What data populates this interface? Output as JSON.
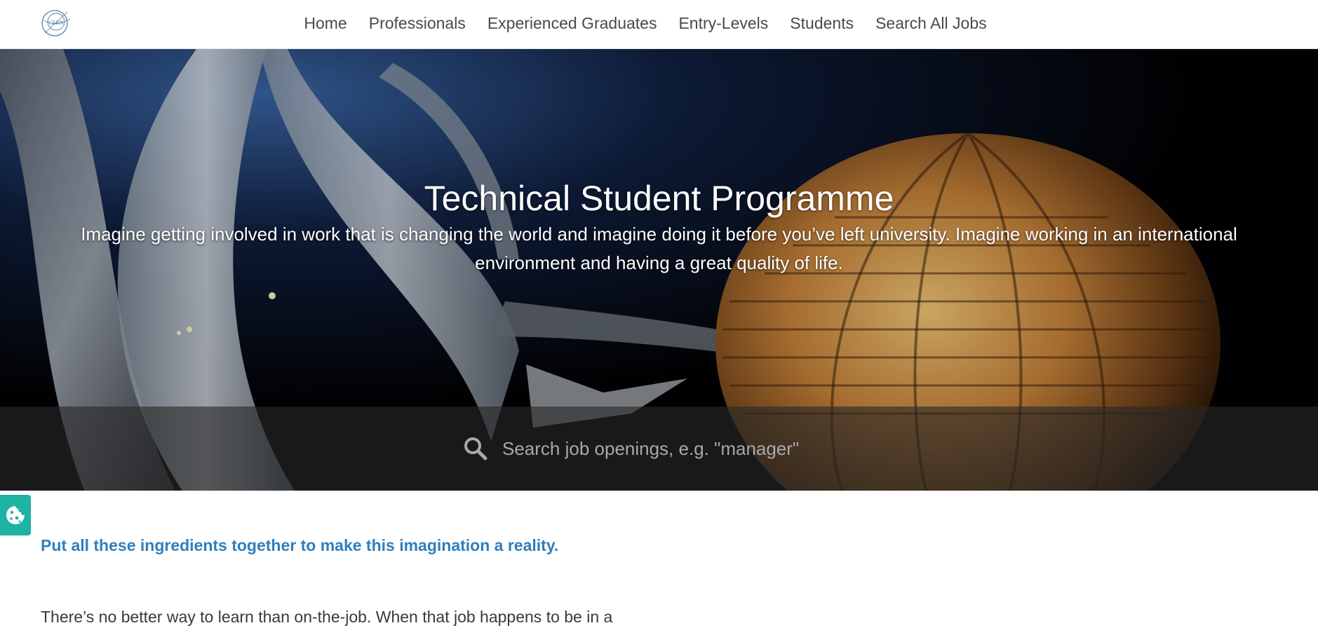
{
  "nav": {
    "logo_text": "CERN",
    "links": [
      {
        "label": "Home"
      },
      {
        "label": "Professionals"
      },
      {
        "label": "Experienced Graduates"
      },
      {
        "label": "Entry-Levels"
      },
      {
        "label": "Students"
      },
      {
        "label": "Search All Jobs"
      }
    ]
  },
  "hero": {
    "title": "Technical Student Programme",
    "subtitle": "Imagine getting involved in work that is changing the world and imagine doing it before you’ve left university. Imagine working in an international environment and having a great quality of life."
  },
  "search": {
    "icon": "search-icon",
    "placeholder": "Search job openings, e.g. \"manager\""
  },
  "cookie": {
    "icon": "cookie-icon",
    "color": "#1fb3a6"
  },
  "content": {
    "tagline": "Put all these ingredients together to make this imagination a reality.",
    "paragraph": "There’s no better way to learn than on-the-job. When that job happens to be in a"
  },
  "colors": {
    "accent_link": "#2f7fbe",
    "nav_text": "#4a4a4a"
  }
}
